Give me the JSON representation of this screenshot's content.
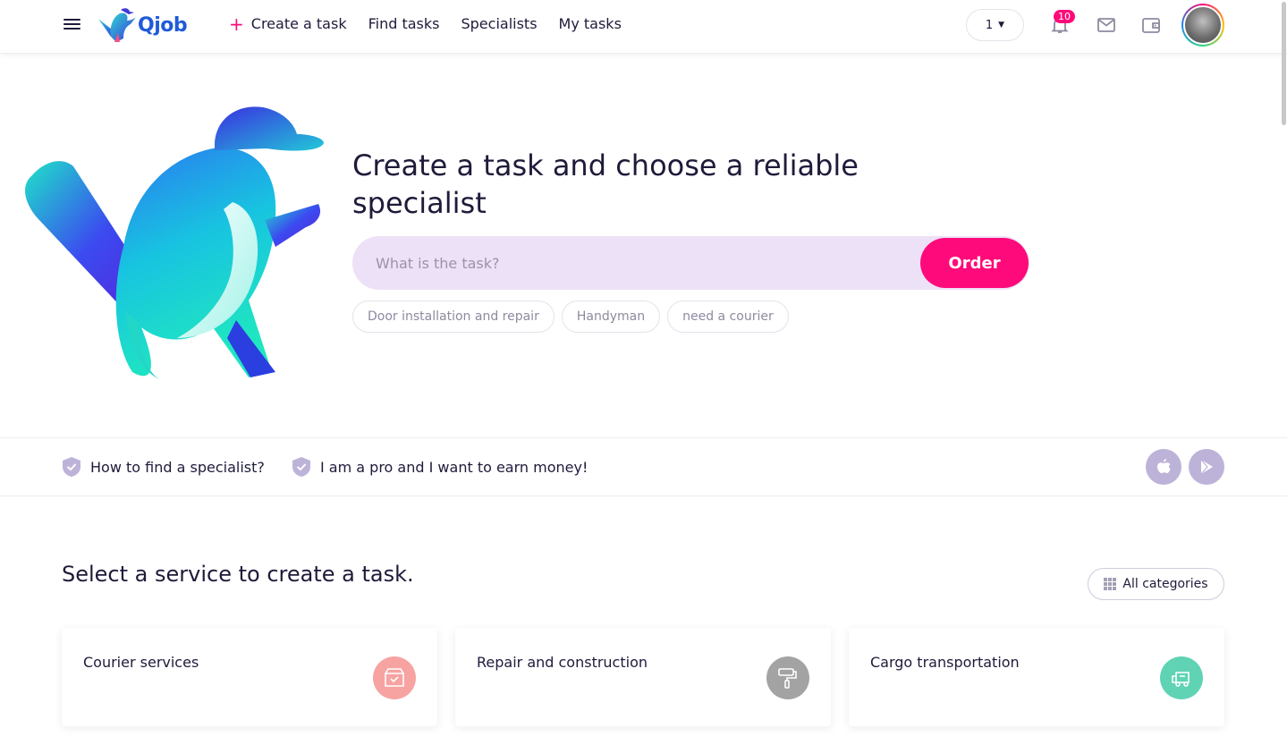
{
  "header": {
    "logo_text": "Qjob",
    "nav": {
      "create_task": "Create a task",
      "find_tasks": "Find tasks",
      "specialists": "Specialists",
      "my_tasks": "My tasks"
    },
    "lang_value": "1",
    "notifications_count": "10"
  },
  "hero": {
    "title": "Create a task and choose a reliable specialist",
    "search_placeholder": "What is the task?",
    "order_label": "Order",
    "chips": [
      "Door installation and repair",
      "Handyman",
      "need a courier"
    ]
  },
  "infobar": {
    "how_to_find": "How to find a specialist?",
    "pro_earn": "I am a pro and I want to earn money!"
  },
  "services": {
    "title": "Select a service to create a task.",
    "all_categories": "All categories",
    "cards": [
      {
        "label": "Courier services",
        "icon": "box-icon",
        "color": "#f7a3a1"
      },
      {
        "label": "Repair and construction",
        "icon": "paint-roller-icon",
        "color": "#a3a3a3"
      },
      {
        "label": "Cargo transportation",
        "icon": "truck-icon",
        "color": "#5fd3b4"
      }
    ]
  },
  "colors": {
    "accent": "#ff0a7a",
    "brand_blue": "#1f5bd8",
    "search_bg": "#ede1f7",
    "store_btn": "#bdb3d9"
  }
}
